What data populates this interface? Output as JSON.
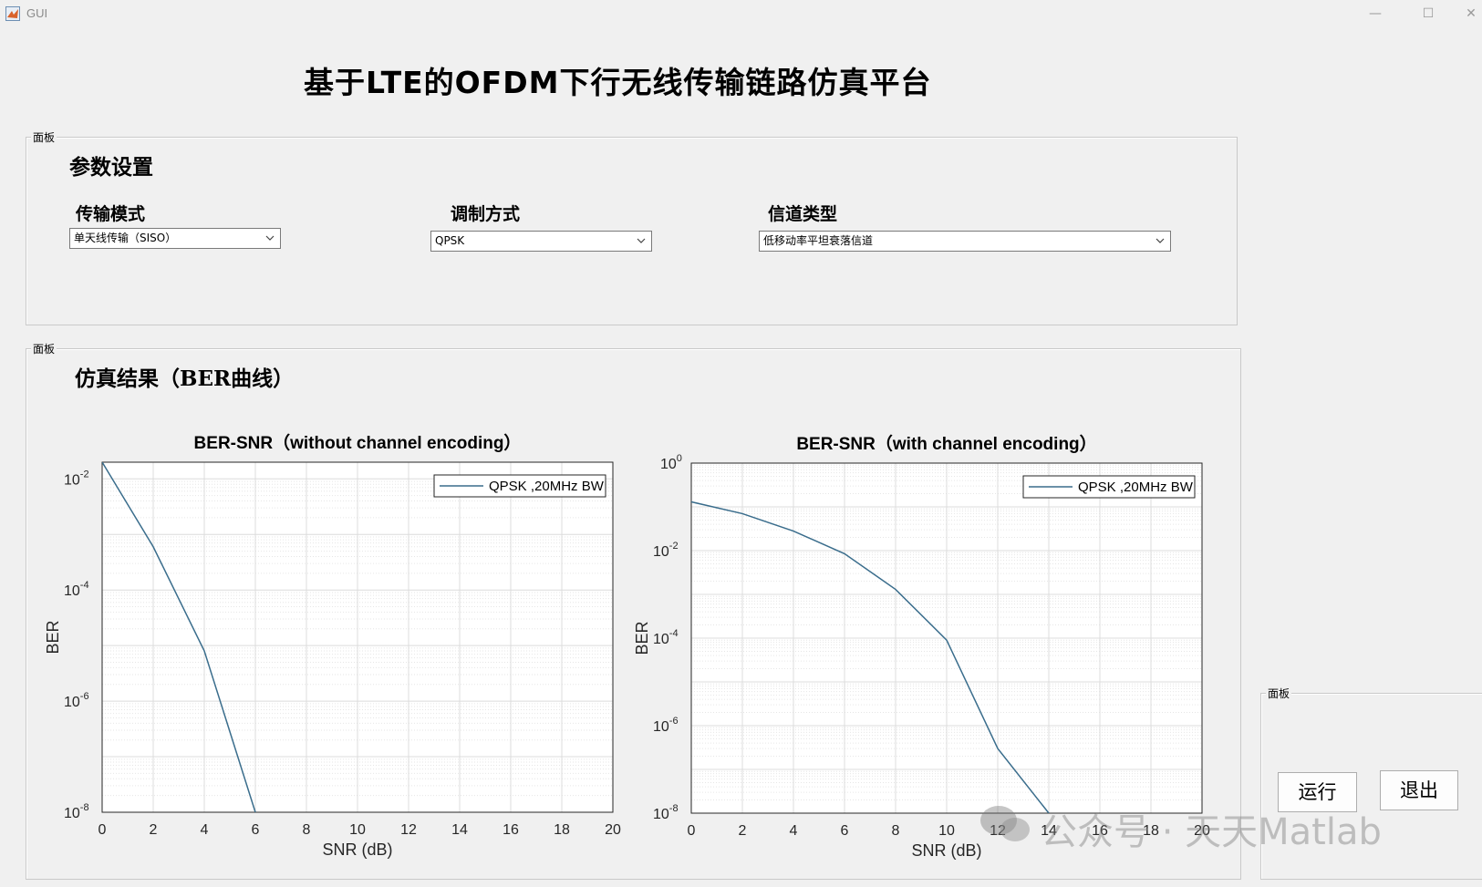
{
  "window": {
    "title": "GUI",
    "minimize_glyph": "—",
    "maximize_glyph": "☐",
    "close_glyph": "✕"
  },
  "main_title": "基于LTE的OFDM下行无线传输链路仿真平台",
  "panel_label": "面板",
  "params": {
    "heading": "参数设置",
    "transmission_mode": {
      "label": "传输模式",
      "value": "单天线传输（SISO）"
    },
    "modulation": {
      "label": "调制方式",
      "value": "QPSK"
    },
    "channel_type": {
      "label": "信道类型",
      "value": "低移动率平坦衰落信道"
    }
  },
  "results": {
    "heading": "仿真结果（BER曲线）"
  },
  "controls": {
    "run_label": "运行",
    "exit_label": "退出"
  },
  "watermark": {
    "text": "公众号 · 天天Matlab"
  },
  "colors": {
    "line": "#3a6d8c",
    "grid": "#dcdcdc"
  },
  "chart_data": [
    {
      "type": "line",
      "title": "BER-SNR（without channel encoding）",
      "xlabel": "SNR (dB)",
      "ylabel": "BER",
      "xlim": [
        0,
        20
      ],
      "x_ticks": [
        0,
        2,
        4,
        6,
        8,
        10,
        12,
        14,
        16,
        18,
        20
      ],
      "ylim_exp": [
        -8,
        -1.7
      ],
      "y_tick_exps": [
        -2,
        -4,
        -6,
        -8
      ],
      "yscale": "log",
      "grid": true,
      "legend_position": "top-right",
      "series": [
        {
          "name": "QPSK ,20MHz BW",
          "x": [
            0,
            2,
            4,
            6
          ],
          "y": [
            0.02,
            0.0006,
            8e-06,
            1e-08
          ]
        }
      ]
    },
    {
      "type": "line",
      "title": "BER-SNR（with channel encoding）",
      "xlabel": "SNR (dB)",
      "ylabel": "BER",
      "xlim": [
        0,
        20
      ],
      "x_ticks": [
        0,
        2,
        4,
        6,
        8,
        10,
        12,
        14,
        16,
        18,
        20
      ],
      "ylim_exp": [
        -8,
        0
      ],
      "y_tick_exps": [
        0,
        -2,
        -4,
        -6,
        -8
      ],
      "yscale": "log",
      "grid": true,
      "legend_position": "top-right",
      "series": [
        {
          "name": "QPSK ,20MHz BW",
          "x": [
            0,
            2,
            4,
            6,
            8,
            10,
            12,
            14
          ],
          "y": [
            0.13,
            0.07,
            0.028,
            0.0085,
            0.0013,
            9e-05,
            3e-07,
            1e-08
          ]
        }
      ]
    }
  ]
}
